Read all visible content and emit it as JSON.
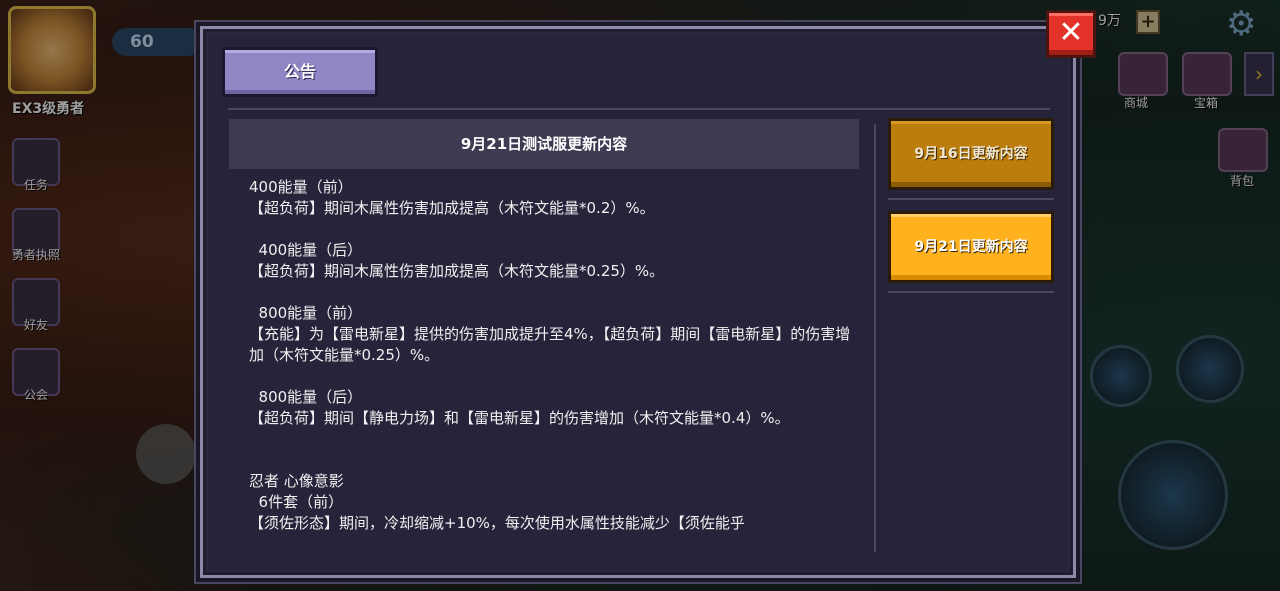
{
  "hud": {
    "level": "60",
    "rank_title": "EX3级勇者",
    "coins": "9万",
    "plus": "+",
    "left_menu": [
      {
        "label": "任务",
        "icon": "scroll-icon"
      },
      {
        "label": "勇者执照",
        "icon": "badge-icon"
      },
      {
        "label": "好友",
        "icon": "friend-icon"
      },
      {
        "label": "公会",
        "icon": "guild-icon"
      }
    ],
    "right_menu": [
      {
        "label": "商城",
        "icon": "shop-icon"
      },
      {
        "label": "宝箱",
        "icon": "chest-icon"
      },
      {
        "label": "背包",
        "icon": "backpack-icon"
      }
    ],
    "expand_arrow": "›"
  },
  "dialog": {
    "tab_label": "公告",
    "close_glyph": "✕",
    "content_title": "9月21日测试服更新内容",
    "content_text": "400能量（前）\n【超负荷】期间木属性伤害加成提高（木符文能量*0.2）%。\n\n  400能量（后）\n【超负荷】期间木属性伤害加成提高（木符文能量*0.25）%。\n\n  800能量（前）\n【充能】为【雷电新星】提供的伤害加成提升至4%，【超负荷】期间【雷电新星】的伤害增加（木符文能量*0.25）%。\n\n  800能量（后）\n【超负荷】期间【静电力场】和【雷电新星】的伤害增加（木符文能量*0.4）%。\n\n\n忍者 心像意影\n  6件套（前）\n【须佐形态】期间，冷却缩减+10%，每次使用水属性技能减少【须佐能乎",
    "list": [
      {
        "label": "9月16日更新内容",
        "active": false
      },
      {
        "label": "9月21日更新内容",
        "active": true
      }
    ]
  }
}
